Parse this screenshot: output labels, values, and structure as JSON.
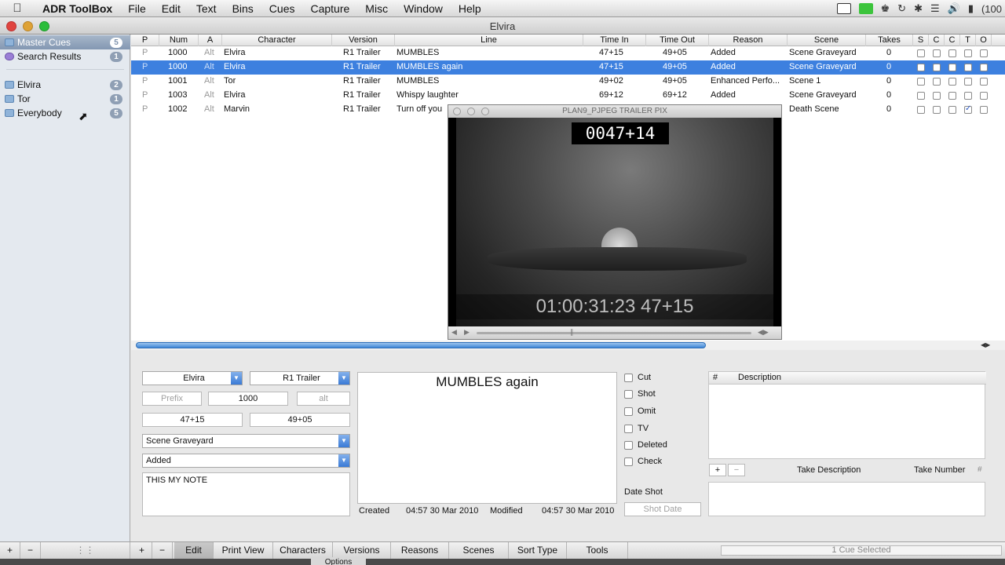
{
  "menubar": {
    "app": "ADR ToolBox",
    "menus": [
      "File",
      "Edit",
      "Text",
      "Bins",
      "Cues",
      "Capture",
      "Misc",
      "Window",
      "Help"
    ],
    "battery": "(100"
  },
  "window": {
    "title": "Elvira"
  },
  "sidebar": {
    "items": [
      {
        "label": "Master Cues",
        "count": "5"
      },
      {
        "label": "Search Results",
        "count": "1"
      },
      {
        "label": "Elvira",
        "count": "2"
      },
      {
        "label": "Tor",
        "count": "1"
      },
      {
        "label": "Everybody",
        "count": "5"
      }
    ]
  },
  "table": {
    "headers": [
      "P",
      "Num",
      "A",
      "Character",
      "Version",
      "Line",
      "Time In",
      "Time Out",
      "Reason",
      "Scene",
      "Takes",
      "S",
      "C",
      "C",
      "T",
      "O"
    ],
    "rows": [
      {
        "p": "P",
        "num": "1000",
        "a": "Alt",
        "character": "Elvira",
        "version": "R1 Trailer",
        "line": "MUMBLES",
        "time_in": "47+15",
        "time_out": "49+05",
        "reason": "Added",
        "scene": "Scene Graveyard",
        "takes": "0"
      },
      {
        "p": "P",
        "num": "1000",
        "a": "Alt",
        "character": "Elvira",
        "version": "R1 Trailer",
        "line": "MUMBLES again",
        "time_in": "47+15",
        "time_out": "49+05",
        "reason": "Added",
        "scene": "Scene Graveyard",
        "takes": "0"
      },
      {
        "p": "P",
        "num": "1001",
        "a": "Alt",
        "character": "Tor",
        "version": "R1 Trailer",
        "line": "MUMBLES",
        "time_in": "49+02",
        "time_out": "49+05",
        "reason": "Enhanced Perfo...",
        "scene": "Scene 1",
        "takes": "0"
      },
      {
        "p": "P",
        "num": "1003",
        "a": "Alt",
        "character": "Elvira",
        "version": "R1 Trailer",
        "line": "Whispy laughter",
        "time_in": "69+12",
        "time_out": "69+12",
        "reason": "Added",
        "scene": "Scene Graveyard",
        "takes": "0"
      },
      {
        "p": "P",
        "num": "1002",
        "a": "Alt",
        "character": "Marvin",
        "version": "R1 Trailer",
        "line": "Turn off you",
        "time_in": "",
        "time_out": "",
        "reason": "",
        "scene": "Death Scene",
        "takes": "0"
      }
    ]
  },
  "video": {
    "title": "PLAN9_PJPEG TRAILER PIX",
    "timecode_top": "0047+14",
    "timecode_bottom": "01:00:31:23 47+15"
  },
  "editor": {
    "character": "Elvira",
    "version": "R1 Trailer",
    "prefix_placeholder": "Prefix",
    "number": "1000",
    "alt_placeholder": "alt",
    "time_in": "47+15",
    "time_out": "49+05",
    "scene": "Scene Graveyard",
    "reason": "Added",
    "note": "THIS MY NOTE",
    "line_text": "MUMBLES again",
    "created_label": "Created",
    "created_value": "04:57 30 Mar 2010",
    "modified_label": "Modified",
    "modified_value": "04:57 30 Mar 2010",
    "checks": [
      "Cut",
      "Shot",
      "Omit",
      "TV",
      "Deleted",
      "Check"
    ],
    "date_shot_label": "Date Shot",
    "shot_date_placeholder": "Shot Date",
    "desc_hash": "#",
    "desc_header": "Description",
    "take_plus": "+",
    "take_minus": "−",
    "take_description": "Take Description",
    "take_number": "Take Number",
    "take_hash": "#"
  },
  "bottom": {
    "plus": "+",
    "minus": "−",
    "tabs": [
      "Edit",
      "Print View",
      "Characters",
      "Versions",
      "Reasons",
      "Scenes",
      "Sort Type",
      "Tools"
    ],
    "status": "1 Cue Selected",
    "options": "Options"
  },
  "colors": {
    "selection": "#3d80df",
    "accent": "#3a7ad6"
  }
}
